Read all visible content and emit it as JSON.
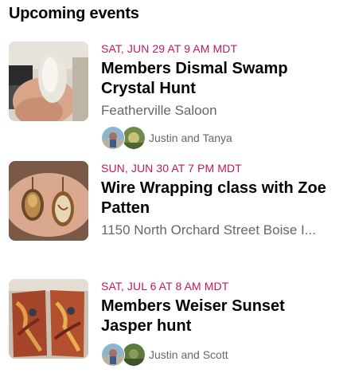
{
  "section": {
    "title": "Upcoming events"
  },
  "events": [
    {
      "date": "SAT, JUN 29 AT 9 AM MDT",
      "name": "Members Dismal Swamp Crystal Hunt",
      "location": "Featherville Saloon",
      "going": "Justin and Tanya",
      "thumb_icon": "crystal-photo"
    },
    {
      "date": "SUN, JUN 30 AT 7 PM MDT",
      "name": "Wire Wrapping class with Zoe Patten",
      "location": "1150 North Orchard Street Boise I...",
      "thumb_icon": "wire-wrapped-pendants-photo"
    },
    {
      "date": "SAT, JUL 6 AT 8 AM MDT",
      "name": "Members Weiser Sunset Jasper hunt",
      "going": "Justin and Scott",
      "thumb_icon": "jasper-slabs-photo"
    }
  ],
  "colors": {
    "date": "#c2185b",
    "secondary_text": "#65676b",
    "primary_text": "#050505"
  }
}
